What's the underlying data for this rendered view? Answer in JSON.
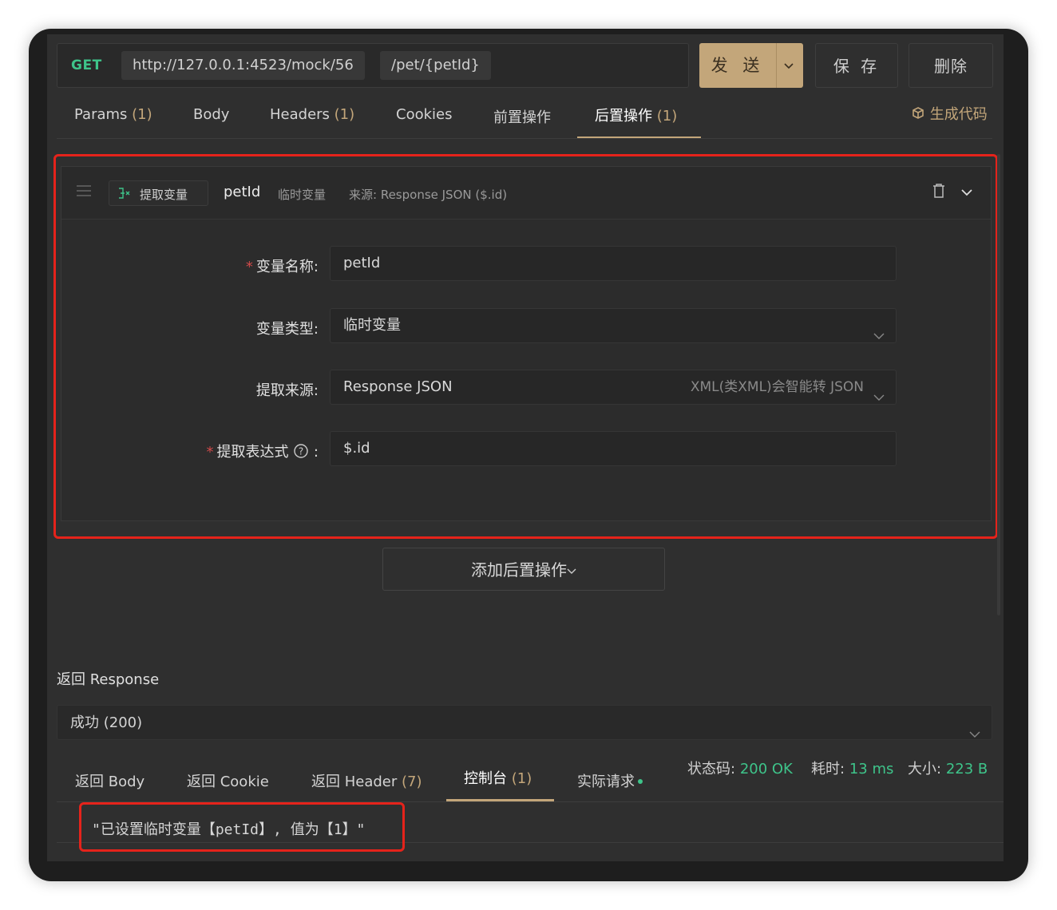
{
  "request": {
    "method": "GET",
    "base_url": "http://127.0.0.1:4523/mock/56",
    "path": "/pet/{petId}",
    "send_label": "发 送",
    "save_label": "保 存",
    "delete_label": "删除"
  },
  "tabs": [
    {
      "label": "Params",
      "count": "(1)"
    },
    {
      "label": "Body",
      "count": ""
    },
    {
      "label": "Headers",
      "count": "(1)"
    },
    {
      "label": "Cookies",
      "count": ""
    },
    {
      "label": "前置操作",
      "count": ""
    },
    {
      "label": "后置操作",
      "count": "(1)",
      "active": true
    }
  ],
  "generate_code_label": "生成代码",
  "post_op": {
    "type_badge": "提取变量",
    "var_name": "petId",
    "var_scope": "临时变量",
    "source_summary": "来源: Response JSON ($.id)",
    "form": {
      "name_label": "变量名称",
      "name_value": "petId",
      "type_label": "变量类型",
      "type_value": "临时变量",
      "source_label": "提取来源",
      "source_value": "Response JSON",
      "source_hint": "XML(类XML)会智能转 JSON",
      "expr_label": "提取表达式",
      "expr_value": "$.id"
    }
  },
  "add_post_op_label": "添加后置操作",
  "response": {
    "section_title": "返回 Response",
    "status_select": "成功 (200)",
    "tabs": [
      {
        "label": "返回 Body",
        "count": ""
      },
      {
        "label": "返回 Cookie",
        "count": ""
      },
      {
        "label": "返回 Header",
        "count": "(7)"
      },
      {
        "label": "控制台",
        "count": "(1)",
        "active": true
      },
      {
        "label": "实际请求",
        "count": ""
      }
    ],
    "status_code_label": "状态码:",
    "status_code_value": "200 OK",
    "time_label": "耗时:",
    "time_value": "13 ms",
    "size_label": "大小:",
    "size_value": "223 B",
    "console_output": "\"已设置临时变量【petId】, 值为【1】\""
  },
  "colors": {
    "accent": "#c3a67a",
    "method_green": "#3ec48a",
    "highlight_red": "#e5231b",
    "panel_bg": "#2f2f2f"
  }
}
